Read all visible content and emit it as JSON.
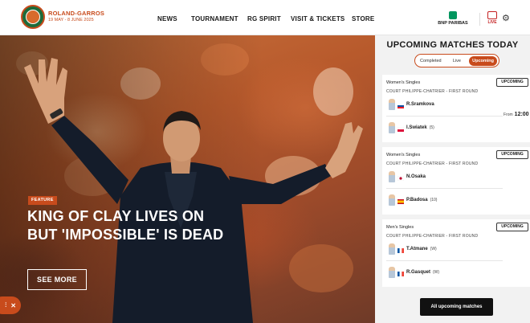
{
  "brand": {
    "name": "ROLAND-GARROS",
    "dates": "19 MAY - 8 JUNE 2025"
  },
  "nav": [
    "NEWS",
    "TOURNAMENT",
    "RG SPIRIT",
    "VISIT & TICKETS",
    "STORE"
  ],
  "sponsor": {
    "name": "BNP PARIBAS"
  },
  "live_label": "LIVE",
  "hero": {
    "tag": "FEATURE",
    "headline": "KING OF CLAY LIVES ON BUT 'IMPOSSIBLE' IS DEAD",
    "cta": "SEE MORE"
  },
  "panel": {
    "title": "UPCOMING MATCHES TODAY",
    "tabs": [
      "Completed",
      "Live",
      "Upcoming"
    ],
    "active_tab": "Upcoming",
    "matches": [
      {
        "category": "Women's Singles",
        "badge": "UPCOMING",
        "court": "COURT PHILIPPE-CHATRIER - FIRST ROUND",
        "players": [
          {
            "name": "R.Sramkova",
            "seed": "",
            "flag": "SVK"
          },
          {
            "name": "I.Swiatek",
            "seed": "(5)",
            "flag": "POL"
          }
        ],
        "time_prefix": "From",
        "time": "12:00"
      },
      {
        "category": "Women's Singles",
        "badge": "UPCOMING",
        "court": "COURT PHILIPPE-CHATRIER - FIRST ROUND",
        "players": [
          {
            "name": "N.Osaka",
            "seed": "",
            "flag": "JPN"
          },
          {
            "name": "P.Badosa",
            "seed": "(10)",
            "flag": "ESP"
          }
        ]
      },
      {
        "category": "Men's Singles",
        "badge": "UPCOMING",
        "court": "COURT PHILIPPE-CHATRIER - FIRST ROUND",
        "players": [
          {
            "name": "T.Atmane",
            "seed": "(W)",
            "flag": "FRA"
          },
          {
            "name": "R.Gasquet",
            "seed": "(W)",
            "flag": "FRA"
          }
        ]
      }
    ],
    "all_button": "All upcoming matches"
  },
  "colors": {
    "accent": "#c84b1c",
    "green": "#1d6b3a",
    "live": "#c42021"
  }
}
